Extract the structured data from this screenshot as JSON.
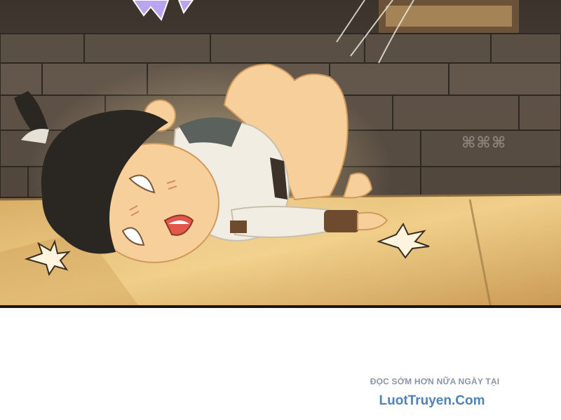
{
  "footer": {
    "promo_line": "ĐỌC SỚM HƠN NỮA NGÀY TẠI",
    "site_name": "LuotTruyen.Com"
  },
  "colors": {
    "stone_dark": "#4a4036",
    "stone_mid": "#5e5246",
    "floor_light": "#e9c27a",
    "floor_shadow": "#b08a4e",
    "hair": "#2a2622",
    "skin": "#f6cf9a",
    "shirt": "#f2ede2",
    "link_blue": "#4e82b8",
    "promo_grey": "#8a96a6"
  },
  "icons": {
    "watermark": "publisher-watermark-logo",
    "impact_marks": "impact-burst-icon"
  }
}
